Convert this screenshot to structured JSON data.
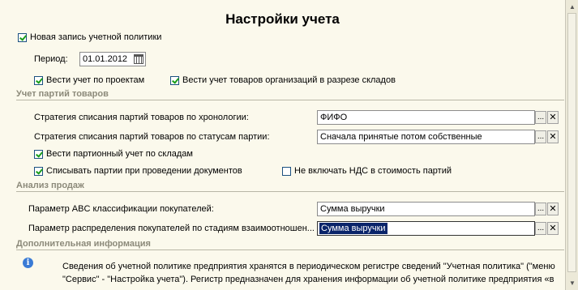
{
  "title": "Настройки учета",
  "new_policy": {
    "label": "Новая запись учетной политики",
    "checked": true
  },
  "period": {
    "label": "Период:",
    "value": "01.01.2012"
  },
  "by_projects": {
    "label": "Вести учет по проектам",
    "checked": true
  },
  "by_warehouses": {
    "label": "Вести учет товаров организаций в разрезе складов",
    "checked": true
  },
  "batches_section": {
    "title": "Учет партий товаров",
    "chronology": {
      "label": "Стратегия списания партий товаров по хронологии:",
      "value": "ФИФО"
    },
    "status": {
      "label": "Стратегия списания партий товаров по статусам партии:",
      "value": "Сначала принятые потом собственные"
    },
    "batch_by_warehouse": {
      "label": "Вести партионный учет по складам",
      "checked": true
    },
    "write_off_on_post": {
      "label": "Списывать партии при проведении документов",
      "checked": true
    },
    "exclude_vat": {
      "label": "Не включать НДС в стоимость партий",
      "checked": false
    }
  },
  "sales_section": {
    "title": "Анализ продаж",
    "abc": {
      "label": "Параметр ABC классификации покупателей:",
      "value": "Сумма выручки"
    },
    "stages": {
      "label": "Параметр распределения покупателей по стадиям взаимоотношен...",
      "value": "Сумма выручки"
    }
  },
  "extra_section": {
    "title": "Дополнительная информация",
    "text": "Сведения об учетной политике предприятия хранятся в периодическом регистре сведений \"Учетная политика\" (\"меню \"Сервис\" -  \"Настройка учета\"). Регистр предназначен для хранения информации об учетной политике предприятия «в"
  },
  "buttons": {
    "select": "...",
    "clear": "✕"
  },
  "icons": {
    "checkbox": "checkbox-icon",
    "calendar": "calendar-icon",
    "info": "info-icon",
    "scroll_up": "scroll-up-icon",
    "scroll_down": "scroll-down-icon"
  },
  "colors": {
    "background": "#fbf9ec",
    "section_title": "#8c8a7a",
    "selection": "#0a246a",
    "check": "#1a9e1a",
    "info": "#3a7bd5"
  }
}
